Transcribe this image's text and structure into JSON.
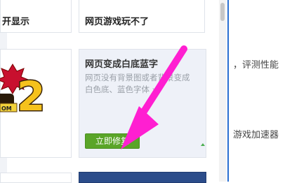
{
  "left_column": {
    "top_card_title": "开显示",
    "game_logo_text": "2",
    "game_logo_subtext": "OM"
  },
  "middle_column": {
    "top_card_title": "网页游戏玩不了",
    "fix_card": {
      "title": "网页变成白底蓝字",
      "desc_line1": "网页没有背景图或者背景变成",
      "desc_line2": "白色底、蓝色字体",
      "more_link": "»",
      "button_label": "立即修复"
    }
  },
  "right_column": {
    "text_1": "，评测性能",
    "text_2": "游戏加速器"
  },
  "colors": {
    "button_green": "#5aa528",
    "annotation_arrow": "#ff1fd1",
    "divider_blue": "#2a6fd1"
  }
}
